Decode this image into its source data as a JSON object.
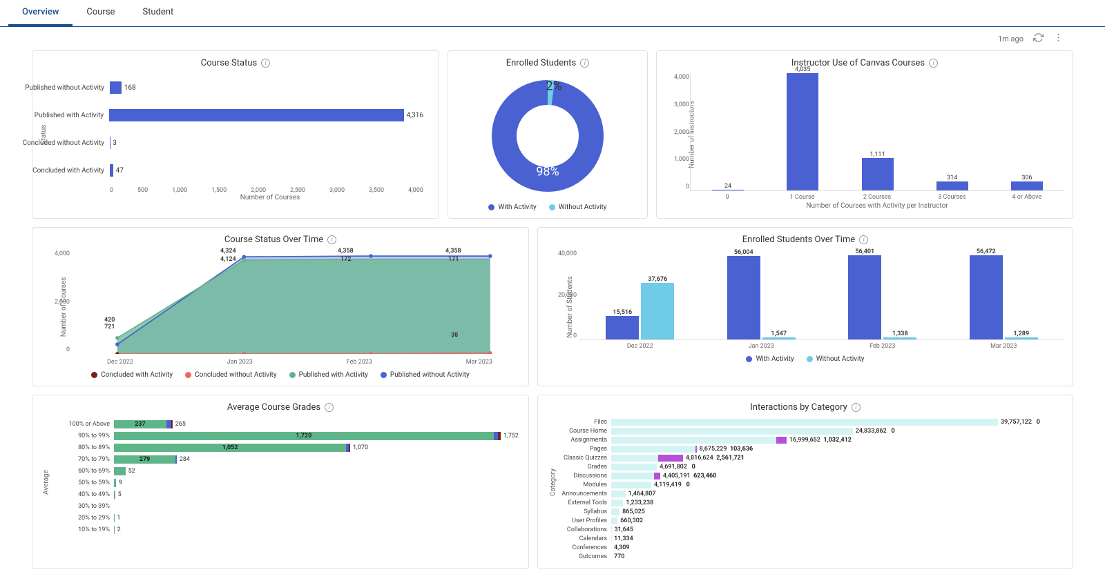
{
  "tabs": {
    "overview": "Overview",
    "course": "Course",
    "student": "Student"
  },
  "topbar": {
    "refreshed": "1m ago"
  },
  "colors": {
    "blue": "#4961d1",
    "lightblue": "#6fcbe8",
    "green": "#5fb58a",
    "darkred": "#7a1f1f",
    "red": "#e86a5f",
    "purple": "#b84fd9",
    "cyan": "#d4f3f3"
  },
  "chart_data": [
    {
      "id": "course_status",
      "type": "bar",
      "orientation": "horizontal",
      "title": "Course Status",
      "ylabel": "Status",
      "xlabel": "Number of Courses",
      "xticks": [
        "0",
        "500",
        "1,000",
        "1,500",
        "2,000",
        "2,500",
        "3,000",
        "3,500",
        "4,000"
      ],
      "xmax": 4316,
      "categories": [
        "Published without Activity",
        "Published with Activity",
        "Concluded without Activity",
        "Concluded with Activity"
      ],
      "values": [
        168,
        4316,
        3,
        47
      ]
    },
    {
      "id": "enrolled_students",
      "type": "donut",
      "title": "Enrolled Students",
      "series": [
        {
          "name": "With Activity",
          "value": 98,
          "color": "#4961d1"
        },
        {
          "name": "Without Activity",
          "value": 2,
          "color": "#6fcbe8"
        }
      ],
      "labels": {
        "with": "98%",
        "without": "2%"
      }
    },
    {
      "id": "instructor_use",
      "type": "bar",
      "title": "Instructor Use of Canvas Courses",
      "ylabel": "Number of Instructors",
      "xlabel": "Number of Courses with Activity per Instructor",
      "ymax": 4035,
      "yticks": [
        "0",
        "1,000",
        "2,000",
        "3,000",
        "4,000"
      ],
      "categories": [
        "0",
        "1 Course",
        "2 Courses",
        "3 Courses",
        "4 or Above"
      ],
      "values": [
        24,
        4035,
        1111,
        314,
        306
      ]
    },
    {
      "id": "course_status_time",
      "type": "area",
      "title": "Course Status Over Time",
      "ylabel": "Number of Courses",
      "yticks": [
        "0",
        "2,000",
        "4,000"
      ],
      "x": [
        "Dec 2022",
        "Jan 2023",
        "Feb 2023",
        "Mar 2023"
      ],
      "series": [
        {
          "name": "Published without Activity",
          "color": "#4961d1",
          "values": [
            420,
            4324,
            4358,
            4358
          ]
        },
        {
          "name": "Published with Activity",
          "color": "#5fb58a",
          "values": [
            721,
            4124,
            172,
            171
          ],
          "true_values": [
            721,
            4124,
            4172,
            4171
          ]
        },
        {
          "name": "Concluded without Activity",
          "color": "#e86a5f",
          "values": [
            0,
            0,
            4,
            38
          ]
        },
        {
          "name": "Concluded with Activity",
          "color": "#7a1f1f",
          "values": [
            0,
            0,
            0,
            0
          ]
        }
      ],
      "point_labels": {
        "dec": [
          "420",
          "721"
        ],
        "jan": [
          "4,324",
          "4,124"
        ],
        "feb": [
          "4,358",
          "172"
        ],
        "mar": [
          "4,358",
          "171",
          "38"
        ]
      }
    },
    {
      "id": "enrolled_time",
      "type": "bar_grouped",
      "title": "Enrolled Students Over Time",
      "ylabel": "Number of Students",
      "ymax": 60000,
      "yticks": [
        "0",
        "20,000",
        "40,000"
      ],
      "x": [
        "Dec 2022",
        "Jan 2023",
        "Feb 2023",
        "Mar 2023"
      ],
      "series": [
        {
          "name": "With Activity",
          "color": "#4961d1",
          "values": [
            15516,
            56004,
            56401,
            56472
          ]
        },
        {
          "name": "Without Activity",
          "color": "#6fcbe8",
          "values": [
            37676,
            1547,
            1338,
            1289
          ]
        }
      ]
    },
    {
      "id": "avg_grades",
      "type": "bar_stacked",
      "orientation": "horizontal",
      "title": "Average Course Grades",
      "ylabel": "Average",
      "xmax": 1752,
      "categories": [
        "100% or Above",
        "90% to 99%",
        "80% to 89%",
        "70% to 79%",
        "60% to 69%",
        "50% to 59%",
        "40% to 49%",
        "30% to 39%",
        "20% to 29%",
        "10% to 19%"
      ],
      "series": [
        {
          "name": "Published with Activity",
          "color": "#5fb58a",
          "values": [
            237,
            1720,
            1052,
            279,
            52,
            9,
            5,
            0,
            1,
            2
          ]
        },
        {
          "name": "Published without Activity",
          "color": "#4961d1",
          "values": [
            23,
            18,
            11,
            5,
            0,
            0,
            0,
            0,
            0,
            0
          ]
        },
        {
          "name": "Concluded",
          "color": "#7a1f1f",
          "values": [
            5,
            14,
            7,
            0,
            0,
            0,
            0,
            0,
            0,
            0
          ]
        }
      ],
      "totals": [
        265,
        1752,
        1070,
        284,
        52,
        9,
        5,
        0,
        1,
        2
      ]
    },
    {
      "id": "interactions",
      "type": "bar_stacked",
      "orientation": "horizontal",
      "title": "Interactions by Category",
      "ylabel": "Category",
      "xmax": 39757122,
      "categories": [
        "Files",
        "Course Home",
        "Assignments",
        "Pages",
        "Classic Quizzes",
        "Grades",
        "Discussions",
        "Modules",
        "Announcements",
        "External Tools",
        "Syllabus",
        "User Profiles",
        "Collaborations",
        "Calendars",
        "Conferences",
        "Outcomes"
      ],
      "series": [
        {
          "name": "main",
          "color": "#d4f3f3",
          "values": [
            39757122,
            24833862,
            16999652,
            8675229,
            4816624,
            4691802,
            4405191,
            4119419,
            1464807,
            1233238,
            865025,
            660302,
            31645,
            11334,
            4309,
            770
          ]
        },
        {
          "name": "secondary",
          "color": "#b84fd9",
          "values": [
            0,
            0,
            1032412,
            103636,
            2561721,
            0,
            623460,
            0,
            0,
            0,
            0,
            0,
            0,
            0,
            0,
            0
          ]
        }
      ],
      "extra_labels": {
        "Files": "0",
        "Course Home": "0",
        "Grades": "0",
        "Modules": "0"
      }
    }
  ],
  "legends": {
    "enrolled": [
      "With Activity",
      "Without Activity"
    ],
    "status_time": [
      "Concluded with Activity",
      "Concluded without Activity",
      "Published with Activity",
      "Published without Activity"
    ]
  }
}
